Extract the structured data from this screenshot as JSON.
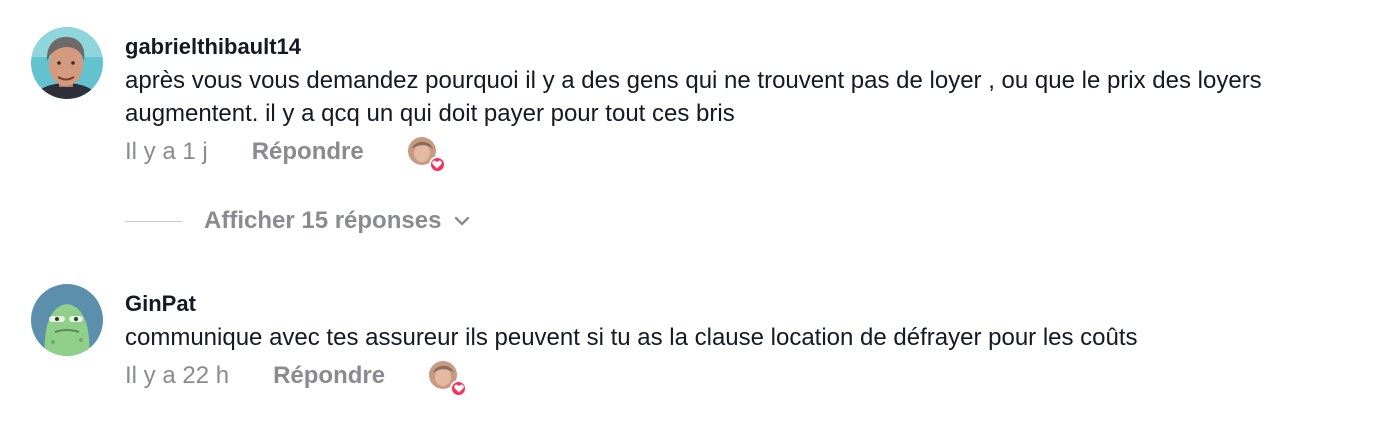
{
  "comments": [
    {
      "username": "gabrielthibault14",
      "text": "après vous vous demandez pourquoi il y a des gens qui ne trouvent pas de loyer , ou que le prix des loyers augmentent. il y a qcq un qui doit payer pour tout ces bris",
      "time": "Il y a 1 j",
      "reply_label": "Répondre",
      "avatar_icon": "user-photo-avatar",
      "liked_by_creator": true
    },
    {
      "username": "GinPat",
      "text": "communique avec tes assureur ils peuvent si tu as la clause location de défrayer pour les coûts",
      "time": "Il y a 22 h",
      "reply_label": "Répondre",
      "avatar_icon": "green-character-avatar",
      "liked_by_creator": true
    }
  ],
  "view_replies": {
    "label": "Afficher 15 réponses",
    "icon": "chevron-down-icon"
  },
  "colors": {
    "text_primary": "#161823",
    "text_secondary": "#8a8b91",
    "heart": "#fe2c55"
  }
}
